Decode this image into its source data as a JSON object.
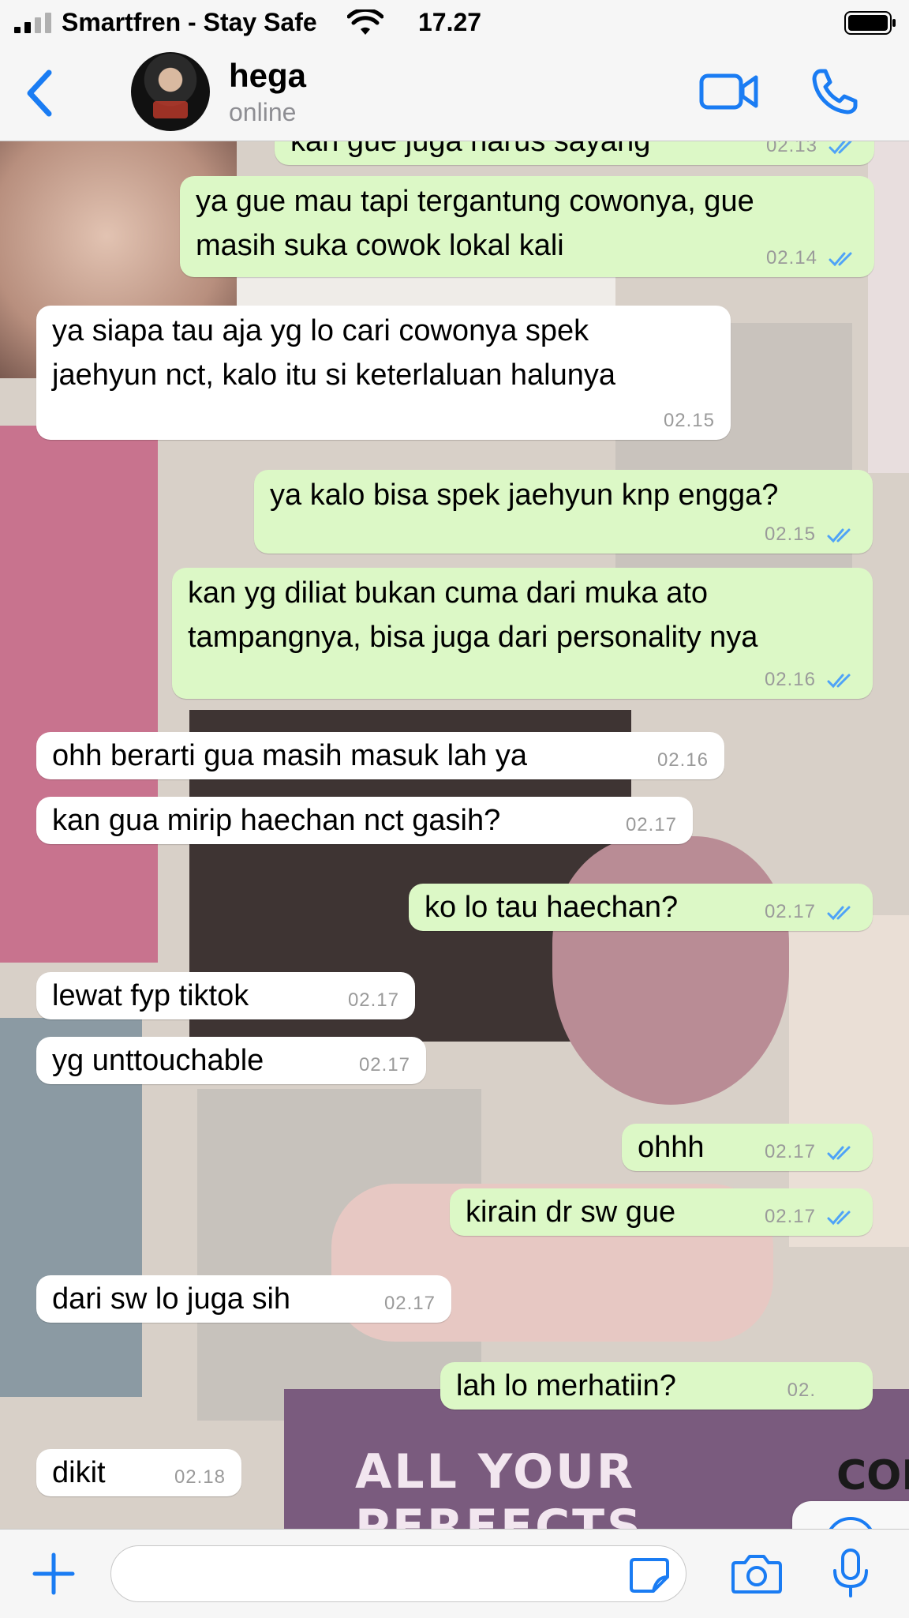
{
  "status_bar": {
    "carrier": "Smartfren - Stay Safe",
    "time": "17.27",
    "icons": [
      "signal-icon",
      "wifi-icon",
      "battery-icon"
    ]
  },
  "header": {
    "contact_name": "hega",
    "contact_status": "online",
    "icons": [
      "back-icon",
      "video-call-icon",
      "phone-call-icon"
    ],
    "accent_color": "#1a7cf3"
  },
  "messages": [
    {
      "direction": "out",
      "lines": [
        "kan gue juga harus sayang"
      ],
      "time": "02.13",
      "read": true
    },
    {
      "direction": "out",
      "lines": [
        "ya gue mau tapi tergantung cowonya, gue",
        "masih suka cowok lokal kali"
      ],
      "time": "02.14",
      "read": true
    },
    {
      "direction": "in",
      "lines": [
        "ya siapa tau aja yg lo cari cowonya spek",
        "jaehyun nct, kalo itu si keterlaluan halunya"
      ],
      "time": "02.15"
    },
    {
      "direction": "out",
      "lines": [
        "ya kalo bisa spek jaehyun knp engga?"
      ],
      "time": "02.15",
      "read": true
    },
    {
      "direction": "out",
      "lines": [
        "kan yg diliat bukan cuma dari muka ato",
        "tampangnya, bisa juga dari personality nya"
      ],
      "time": "02.16",
      "read": true
    },
    {
      "direction": "in",
      "lines": [
        "ohh berarti gua masih masuk lah ya"
      ],
      "time": "02.16"
    },
    {
      "direction": "in",
      "lines": [
        "kan gua mirip haechan nct gasih?"
      ],
      "time": "02.17"
    },
    {
      "direction": "out",
      "lines": [
        "ko lo tau haechan?"
      ],
      "time": "02.17",
      "read": true
    },
    {
      "direction": "in",
      "lines": [
        "lewat fyp tiktok"
      ],
      "time": "02.17"
    },
    {
      "direction": "in",
      "lines": [
        "yg unttouchable"
      ],
      "time": "02.17"
    },
    {
      "direction": "out",
      "lines": [
        "ohhh"
      ],
      "time": "02.17",
      "read": true
    },
    {
      "direction": "out",
      "lines": [
        "kirain dr sw gue"
      ],
      "time": "02.17",
      "read": true
    },
    {
      "direction": "in",
      "lines": [
        "dari sw lo juga sih"
      ],
      "time": "02.17"
    },
    {
      "direction": "out",
      "lines": [
        "lah lo merhatiin?"
      ],
      "time": "02.",
      "read": false
    },
    {
      "direction": "in",
      "lines": [
        "dikit"
      ],
      "time": "02.18"
    }
  ],
  "wallpaper_text": {
    "book_title": "ALL YOUR PERFECTS",
    "book_side": "COL"
  },
  "bottom_bar": {
    "input_value": "",
    "icons": [
      "plus-icon",
      "sticker-icon",
      "camera-icon",
      "microphone-icon"
    ]
  },
  "scroll_button_icon": "chevron-down-circle-icon",
  "colors": {
    "outgoing_bubble": "#dcf8c6",
    "incoming_bubble": "#ffffff",
    "read_ticks": "#4fa3f7",
    "timestamp": "#9a9a9a"
  }
}
